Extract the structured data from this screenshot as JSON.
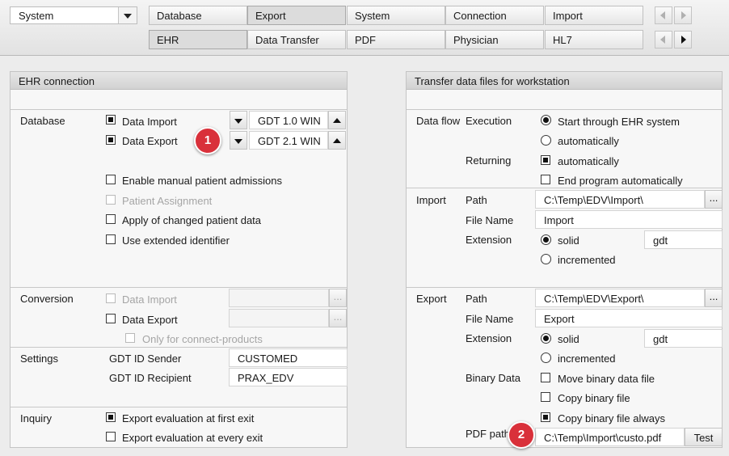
{
  "top": {
    "system_select": "System",
    "tabs_row1": [
      "Database",
      "Export",
      "System",
      "Connection",
      "Import"
    ],
    "tabs_row2": [
      "EHR",
      "Data Transfer",
      "PDF",
      "Physician",
      "HL7"
    ]
  },
  "left": {
    "title": "EHR connection",
    "database": {
      "section": "Database",
      "data_import": "Data Import",
      "data_import_value": "GDT 1.0 WIN",
      "data_export": "Data Export",
      "data_export_value": "GDT 2.1 WIN",
      "manual_admissions": "Enable manual patient admissions",
      "patient_assignment": "Patient Assignment",
      "changed_data": "Apply of changed patient data",
      "extended_id": "Use extended identifier"
    },
    "conversion": {
      "section": "Conversion",
      "data_import": "Data Import",
      "data_export": "Data Export",
      "connect_only": "Only for connect-products",
      "dots": "..."
    },
    "settings": {
      "section": "Settings",
      "sender_label": "GDT ID Sender",
      "sender_value": "CUSTOMED",
      "recipient_label": "GDT ID Recipient",
      "recipient_value": "PRAX_EDV"
    },
    "inquiry": {
      "section": "Inquiry",
      "first_exit": "Export evaluation at first exit",
      "every_exit": "Export evaluation at every exit"
    }
  },
  "right": {
    "title": "Transfer data files for workstation",
    "dataflow": {
      "section": "Data flow",
      "execution": "Execution",
      "start_ehr": "Start through EHR system",
      "auto": "automatically",
      "returning": "Returning",
      "ret_auto": "automatically",
      "end_program": "End program automatically"
    },
    "import": {
      "section": "Import",
      "path_label": "Path",
      "path": "C:\\Temp\\EDV\\Import\\",
      "filename_label": "File Name",
      "filename": "Import",
      "ext_label": "Extension",
      "solid": "solid",
      "ext_value": "gdt",
      "incremented": "incremented",
      "dots": "..."
    },
    "export": {
      "section": "Export",
      "path_label": "Path",
      "path": "C:\\Temp\\EDV\\Export\\",
      "filename_label": "File Name",
      "filename": "Export",
      "ext_label": "Extension",
      "solid": "solid",
      "ext_value": "gdt",
      "incremented": "incremented",
      "binary_label": "Binary Data",
      "move_binary": "Move binary data file",
      "copy_binary": "Copy binary file",
      "copy_always": "Copy binary file always",
      "pdf_label": "PDF path",
      "pdf_path": "C:\\Temp\\Import\\custo.pdf",
      "test": "Test",
      "dots": "..."
    }
  },
  "badges": [
    "1",
    "2"
  ],
  "colors": {
    "badge": "#d9303a",
    "panel_header": "#d8d8d8"
  }
}
